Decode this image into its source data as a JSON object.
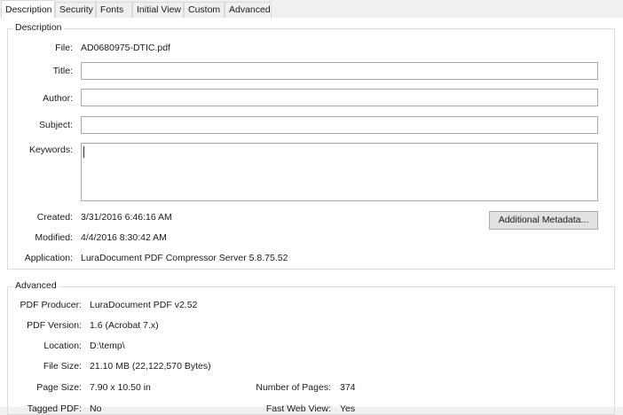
{
  "tabs": [
    "Description",
    "Security",
    "Fonts",
    "Initial View",
    "Custom",
    "Advanced"
  ],
  "description": {
    "group_title": "Description",
    "file_label": "File:",
    "file_value": "AD0680975-DTIC.pdf",
    "title_label": "Title:",
    "title_value": "",
    "author_label": "Author:",
    "author_value": "",
    "subject_label": "Subject:",
    "subject_value": "",
    "keywords_label": "Keywords:",
    "keywords_value": "",
    "created_label": "Created:",
    "created_value": "3/31/2016 6:46:16 AM",
    "modified_label": "Modified:",
    "modified_value": "4/4/2016 8:30:42 AM",
    "application_label": "Application:",
    "application_value": "LuraDocument PDF Compressor Server 5.8.75.52",
    "metadata_button": "Additional Metadata..."
  },
  "advanced": {
    "group_title": "Advanced",
    "producer_label": "PDF Producer:",
    "producer_value": "LuraDocument PDF v2.52",
    "version_label": "PDF Version:",
    "version_value": "1.6 (Acrobat 7.x)",
    "location_label": "Location:",
    "location_value": "D:\\temp\\",
    "filesize_label": "File Size:",
    "filesize_value": "21.10 MB (22,122,570 Bytes)",
    "pagesize_label": "Page Size:",
    "pagesize_value": "7.90 x 10.50 in",
    "numpages_label": "Number of Pages:",
    "numpages_value": "374",
    "tagged_label": "Tagged PDF:",
    "tagged_value": "No",
    "fastweb_label": "Fast Web View:",
    "fastweb_value": "Yes"
  }
}
